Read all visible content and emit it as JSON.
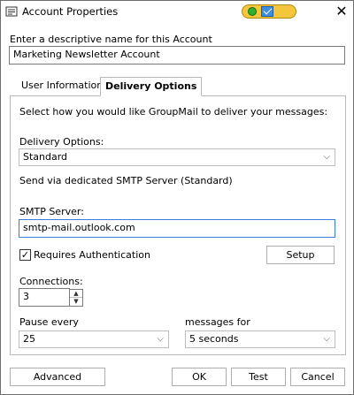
{
  "window": {
    "title": "Account Properties",
    "close_glyph": "✕",
    "status_colors": {
      "online": "#2fb12f",
      "mail": "#3f8ee0",
      "badge": "#f4c63b"
    }
  },
  "name_section": {
    "label": "Enter a descriptive name for this Account",
    "value": "Marketing Newsletter Account"
  },
  "tabs": [
    {
      "label": "User Information",
      "active": false
    },
    {
      "label": "Delivery Options",
      "active": true
    }
  ],
  "delivery": {
    "intro": "Select how you would like GroupMail to deliver your messages:",
    "options_label": "Delivery Options:",
    "options_value": "Standard",
    "description": "Send via dedicated SMTP Server (Standard)",
    "smtp_label": "SMTP Server:",
    "smtp_value": "smtp-mail.outlook.com",
    "requires_auth_label": "Requires Authentication",
    "requires_auth_checked": true,
    "setup_label": "Setup",
    "connections_label": "Connections:",
    "connections_value": "3",
    "pause_label": "Pause every",
    "pause_value": "25",
    "messages_for_label": "messages for",
    "messages_for_value": "5 seconds"
  },
  "footer": {
    "advanced": "Advanced",
    "ok": "OK",
    "test": "Test",
    "cancel": "Cancel"
  },
  "icons": {
    "caret": "⌵",
    "spin_up": "▲",
    "spin_down": "▼",
    "check": "✓"
  }
}
